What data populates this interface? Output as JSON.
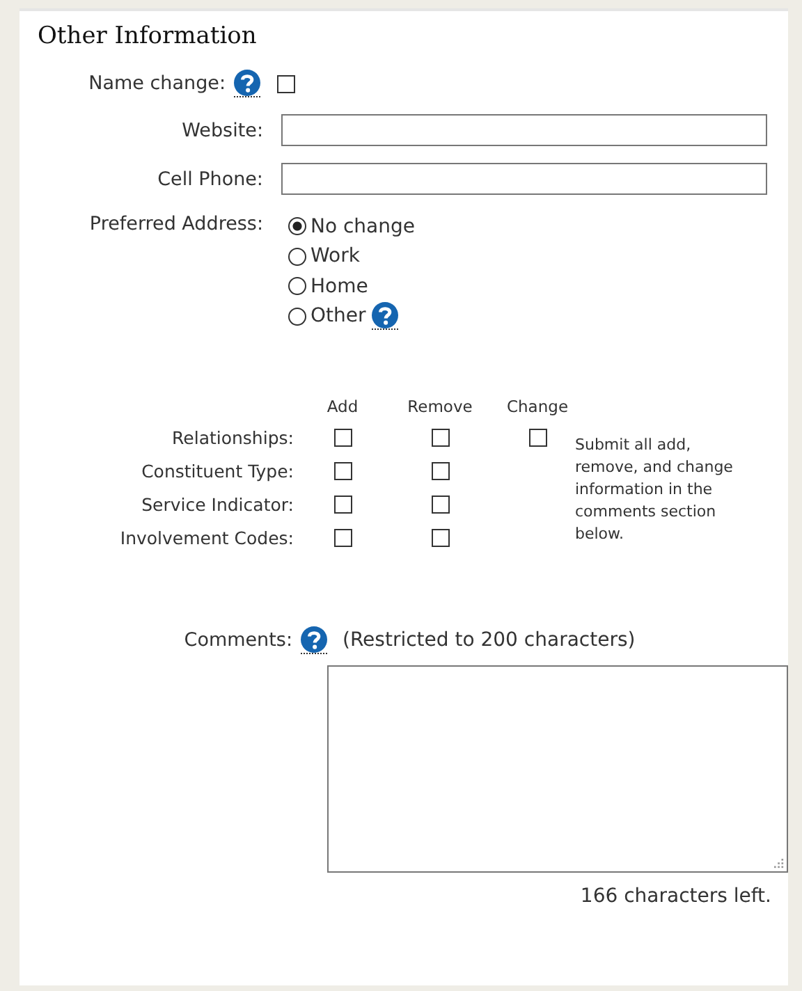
{
  "section": {
    "title": "Other Information"
  },
  "name_change": {
    "label": "Name change:",
    "checked": false
  },
  "fields": [
    {
      "label": "Website:"
    },
    {
      "label": "Cell Phone:"
    }
  ],
  "preferred_address": {
    "label": "Preferred Address:",
    "options": [
      {
        "label": "No change",
        "selected": true,
        "help": false
      },
      {
        "label": "Work",
        "selected": false,
        "help": false
      },
      {
        "label": "Home",
        "selected": false,
        "help": false
      },
      {
        "label": "Other",
        "selected": false,
        "help": true
      }
    ]
  },
  "changes": {
    "columns": [
      "Add",
      "Remove",
      "Change"
    ],
    "rows": [
      {
        "label": "Relationships:",
        "options": [
          {
            "checked": false
          },
          {
            "checked": false
          },
          {
            "checked": false
          }
        ]
      },
      {
        "label": "Constituent Type:",
        "options": [
          {
            "checked": false
          },
          {
            "checked": false
          }
        ]
      },
      {
        "label": "Service Indicator:",
        "options": [
          {
            "checked": false
          },
          {
            "checked": false
          }
        ]
      },
      {
        "label": "Involvement Codes:",
        "options": [
          {
            "checked": false
          },
          {
            "checked": false
          }
        ]
      }
    ],
    "note": "Submit all add, remove, and change information in the comments section below."
  },
  "comments": {
    "label": "Comments:",
    "hint": "(Restricted to 200 characters)",
    "counter": "166 characters left."
  }
}
